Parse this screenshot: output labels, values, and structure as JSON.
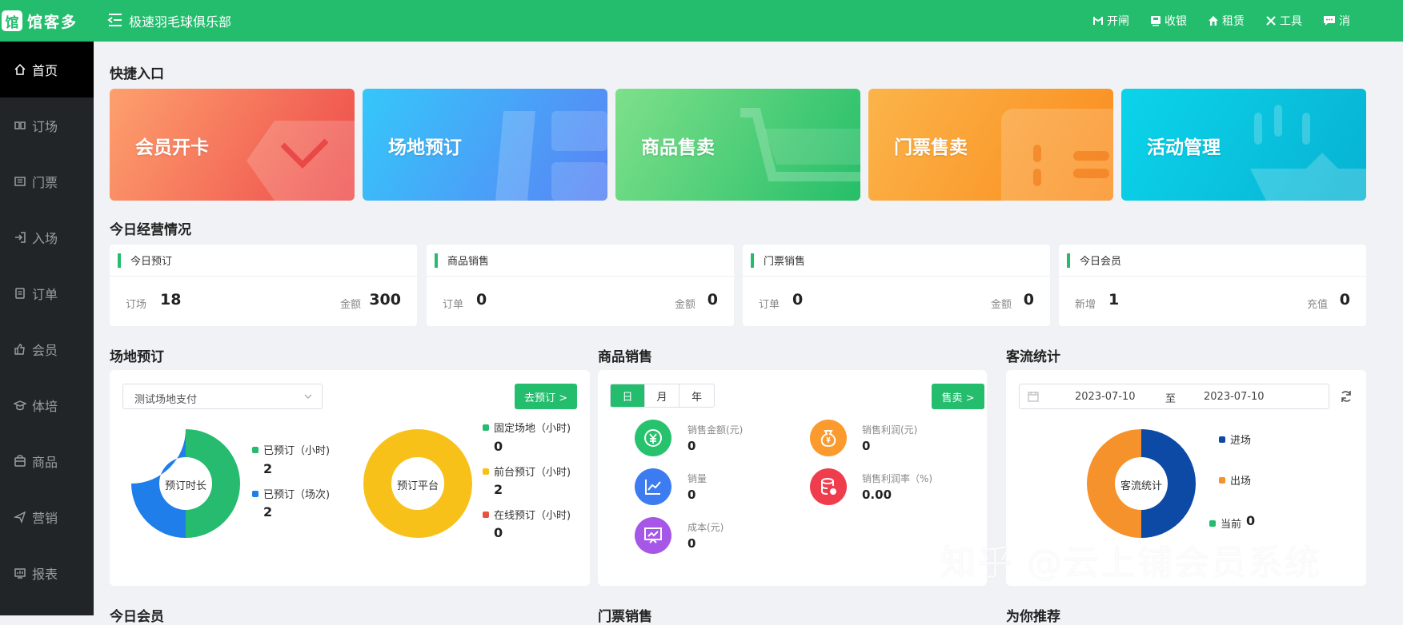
{
  "app": {
    "logo_mark": "馆",
    "logo_text": "馆客多",
    "club_name": "极速羽毛球俱乐部"
  },
  "topnav": [
    {
      "label": "开闸",
      "icon": "gate-icon"
    },
    {
      "label": "收银",
      "icon": "cashier-icon"
    },
    {
      "label": "租赁",
      "icon": "rent-icon"
    },
    {
      "label": "工具",
      "icon": "tools-icon"
    },
    {
      "label": "消",
      "icon": "message-icon"
    }
  ],
  "sidebar": [
    {
      "label": "首页",
      "icon": "home-icon",
      "active": true
    },
    {
      "label": "订场",
      "icon": "book-court-icon"
    },
    {
      "label": "门票",
      "icon": "ticket-icon"
    },
    {
      "label": "入场",
      "icon": "entry-icon"
    },
    {
      "label": "订单",
      "icon": "order-icon"
    },
    {
      "label": "会员",
      "icon": "member-icon"
    },
    {
      "label": "体培",
      "icon": "training-icon"
    },
    {
      "label": "商品",
      "icon": "goods-icon"
    },
    {
      "label": "营销",
      "icon": "marketing-icon"
    },
    {
      "label": "报表",
      "icon": "report-icon"
    }
  ],
  "quick": {
    "title": "快捷入口",
    "cards": [
      {
        "label": "会员开卡",
        "from": "#fda06d",
        "to": "#ee4b4b"
      },
      {
        "label": "场地预订",
        "from": "#35c7fa",
        "to": "#5a83f5"
      },
      {
        "label": "商品售卖",
        "from": "#7ee08a",
        "to": "#26be69"
      },
      {
        "label": "门票售卖",
        "from": "#fbb44a",
        "to": "#fb8c1d"
      },
      {
        "label": "活动管理",
        "from": "#0bd4ea",
        "to": "#08b2d3"
      }
    ]
  },
  "today": {
    "title": "今日经营情况",
    "cards": [
      {
        "title": "今日预订",
        "k1": "订场",
        "v1": "18",
        "k2": "金额",
        "v2": "300"
      },
      {
        "title": "商品销售",
        "k1": "订单",
        "v1": "0",
        "k2": "金额",
        "v2": "0"
      },
      {
        "title": "门票销售",
        "k1": "订单",
        "v1": "0",
        "k2": "金额",
        "v2": "0"
      },
      {
        "title": "今日会员",
        "k1": "新增",
        "v1": "1",
        "k2": "充值",
        "v2": "0"
      }
    ]
  },
  "court": {
    "title": "场地预订",
    "select_value": "测试场地支付",
    "button": "去预订 >",
    "donut1_label": "预订时长",
    "donut1_legend": [
      {
        "label": "已预订（小时)",
        "value": "2",
        "color": "#26bb6f"
      },
      {
        "label": "已预订（场次)",
        "value": "2",
        "color": "#1f7eea"
      }
    ],
    "donut2_label": "预订平台",
    "donut2_legend": [
      {
        "label": "固定场地（小时)",
        "value": "0",
        "color": "#26bb6f"
      },
      {
        "label": "前台预订（小时)",
        "value": "2",
        "color": "#f8c11a"
      },
      {
        "label": "在线预订（小时)",
        "value": "0",
        "color": "#e8533f"
      }
    ]
  },
  "goods": {
    "title": "商品销售",
    "seg": [
      "日",
      "月",
      "年"
    ],
    "button": "售卖 >",
    "metrics": [
      {
        "label": "销售金额(元)",
        "value": "0",
        "icon": "yuan-icon",
        "color": "#27c26e"
      },
      {
        "label": "销售利润(元)",
        "value": "0",
        "icon": "money-bag-icon",
        "color": "#fb9a2d"
      },
      {
        "label": "销量",
        "value": "0",
        "icon": "line-chart-icon",
        "color": "#3c7cf0"
      },
      {
        "label": "销售利润率（%)",
        "value": "0.00",
        "icon": "database-icon",
        "color": "#ef3d4e"
      },
      {
        "label": "成本(元)",
        "value": "0",
        "icon": "presentation-icon",
        "color": "#a657e8"
      }
    ]
  },
  "traffic": {
    "title": "客流统计",
    "date_from": "2023-07-10",
    "date_sep": "至",
    "date_to": "2023-07-10",
    "donut_label": "客流统计",
    "legend": [
      {
        "label": "进场",
        "color": "#0d4aa5"
      },
      {
        "label": "出场",
        "color": "#f6922b"
      },
      {
        "label": "当前",
        "color": "#26bb6f",
        "value": "0"
      }
    ]
  },
  "bottom_titles": [
    "今日会员",
    "门票销售",
    "为你推荐"
  ],
  "watermark": "知乎 @云上铺会员系统"
}
